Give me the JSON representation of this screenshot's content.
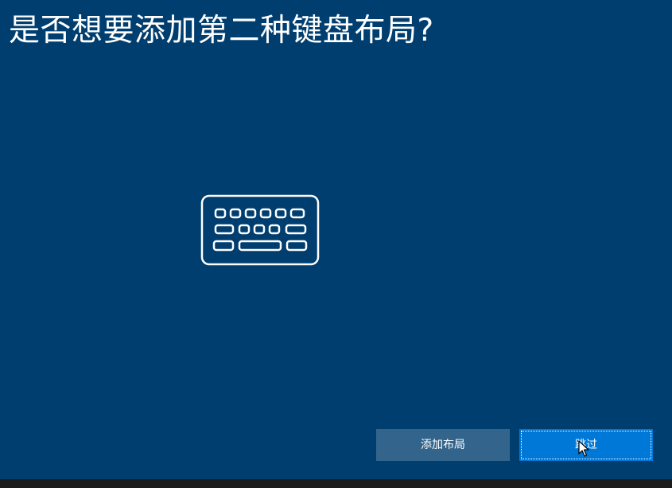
{
  "page": {
    "title": "是否想要添加第二种键盘布局?"
  },
  "illustration": {
    "icon": "keyboard-icon"
  },
  "actions": {
    "add_layout_label": "添加布局",
    "skip_label": "跳过"
  },
  "colors": {
    "background": "#003e6f",
    "primary_button": "#0078d7",
    "secondary_button": "#33658c",
    "taskbar": "#1c1c1c"
  }
}
